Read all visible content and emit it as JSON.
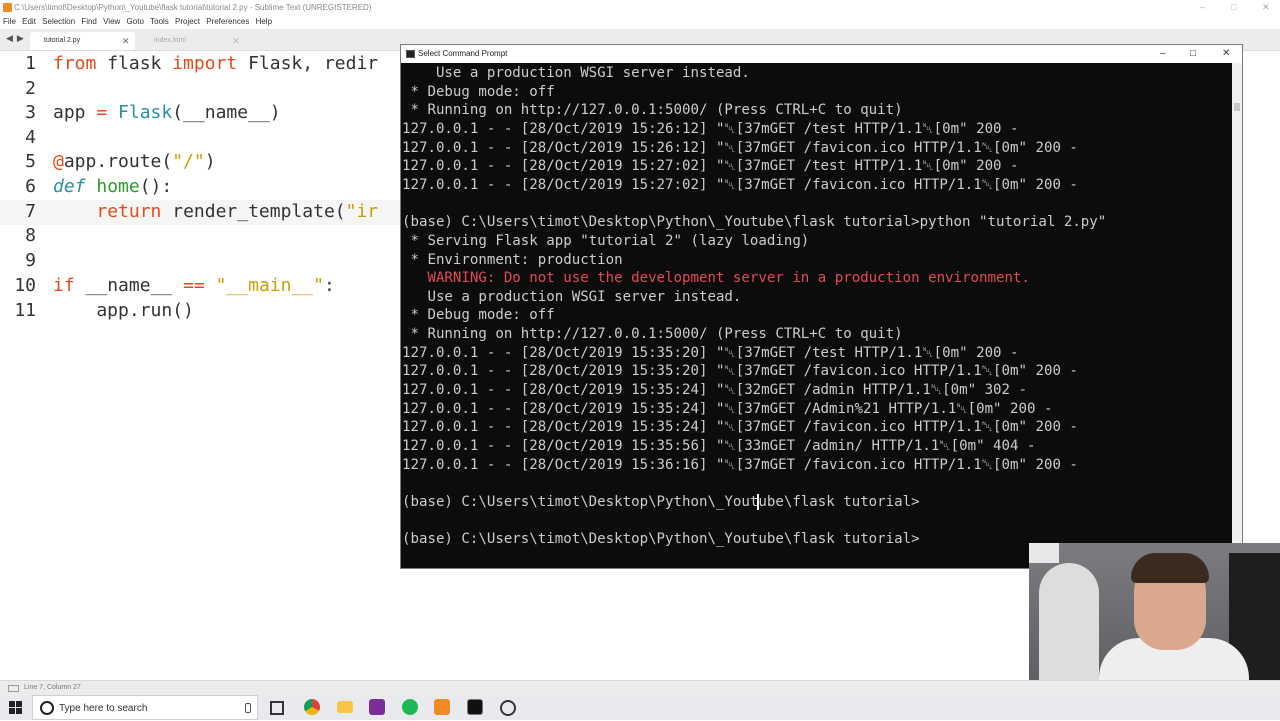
{
  "sublime": {
    "title": "C:\\Users\\timot\\Desktop\\Python\\_Youtube\\flask tutorial\\tutorial 2.py - Sublime Text (UNREGISTERED)",
    "menu": [
      "File",
      "Edit",
      "Selection",
      "Find",
      "View",
      "Goto",
      "Tools",
      "Project",
      "Preferences",
      "Help"
    ],
    "tabs": [
      {
        "label": "tutorial 2.py",
        "active": true
      },
      {
        "label": "index.html",
        "active": false
      }
    ],
    "line_numbers": [
      "1",
      "2",
      "3",
      "4",
      "5",
      "6",
      "7",
      "8",
      "9",
      "10",
      "11"
    ],
    "code": {
      "l1": {
        "kw1": "from",
        "t1": " flask ",
        "kw2": "import",
        "t2": " Flask, redir"
      },
      "l3": {
        "t1": "app ",
        "op": "=",
        "t2": " ",
        "cls": "Flask",
        "t3": "(__name__)"
      },
      "l5": {
        "at": "@",
        "t1": "app.route(",
        "str": "\"/\"",
        "t2": ")"
      },
      "l6": {
        "kw": "def",
        "t1": " ",
        "fn": "home",
        "t2": "():"
      },
      "l7": {
        "ind": "    ",
        "kw": "return",
        "t1": " render_template(",
        "str": "\"ir"
      },
      "l10": {
        "kw": "if",
        "t1": " __name__ ",
        "op": "==",
        "t2": " ",
        "str": "\"__main__\"",
        "t3": ":"
      },
      "l11": {
        "t1": "    app.run()"
      }
    },
    "status": "Line 7, Column 27"
  },
  "cmd": {
    "title": "Select Command Prompt",
    "lines": [
      {
        "text": "    Use a production WSGI server instead.",
        "type": "normal"
      },
      {
        "text": " * Debug mode: off",
        "type": "normal"
      },
      {
        "text": " * Running on http://127.0.0.1:5000/ (Press CTRL+C to quit)",
        "type": "normal"
      },
      {
        "text": "127.0.0.1 - - [28/Oct/2019 15:26:12] \"␀[37mGET /test HTTP/1.1␀[0m\" 200 -",
        "type": "normal"
      },
      {
        "text": "127.0.0.1 - - [28/Oct/2019 15:26:12] \"␀[37mGET /favicon.ico HTTP/1.1␀[0m\" 200 -",
        "type": "normal"
      },
      {
        "text": "127.0.0.1 - - [28/Oct/2019 15:27:02] \"␀[37mGET /test HTTP/1.1␀[0m\" 200 -",
        "type": "normal"
      },
      {
        "text": "127.0.0.1 - - [28/Oct/2019 15:27:02] \"␀[37mGET /favicon.ico HTTP/1.1␀[0m\" 200 -",
        "type": "normal"
      },
      {
        "text": "",
        "type": "normal"
      },
      {
        "text": "(base) C:\\Users\\timot\\Desktop\\Python\\_Youtube\\flask tutorial>python \"tutorial 2.py\"",
        "type": "normal"
      },
      {
        "text": " * Serving Flask app \"tutorial 2\" (lazy loading)",
        "type": "normal"
      },
      {
        "text": " * Environment: production",
        "type": "normal"
      },
      {
        "text": "   WARNING: Do not use the development server in a production environment.",
        "type": "warn"
      },
      {
        "text": "   Use a production WSGI server instead.",
        "type": "normal"
      },
      {
        "text": " * Debug mode: off",
        "type": "normal"
      },
      {
        "text": " * Running on http://127.0.0.1:5000/ (Press CTRL+C to quit)",
        "type": "normal"
      },
      {
        "text": "127.0.0.1 - - [28/Oct/2019 15:35:20] \"␀[37mGET /test HTTP/1.1␀[0m\" 200 -",
        "type": "normal"
      },
      {
        "text": "127.0.0.1 - - [28/Oct/2019 15:35:20] \"␀[37mGET /favicon.ico HTTP/1.1␀[0m\" 200 -",
        "type": "normal"
      },
      {
        "text": "127.0.0.1 - - [28/Oct/2019 15:35:24] \"␀[32mGET /admin HTTP/1.1␀[0m\" 302 -",
        "type": "normal"
      },
      {
        "text": "127.0.0.1 - - [28/Oct/2019 15:35:24] \"␀[37mGET /Admin%21 HTTP/1.1␀[0m\" 200 -",
        "type": "normal"
      },
      {
        "text": "127.0.0.1 - - [28/Oct/2019 15:35:24] \"␀[37mGET /favicon.ico HTTP/1.1␀[0m\" 200 -",
        "type": "normal"
      },
      {
        "text": "127.0.0.1 - - [28/Oct/2019 15:35:56] \"␀[33mGET /admin/ HTTP/1.1␀[0m\" 404 -",
        "type": "normal"
      },
      {
        "text": "127.0.0.1 - - [28/Oct/2019 15:36:16] \"␀[37mGET /favicon.ico HTTP/1.1␀[0m\" 200 -",
        "type": "normal"
      },
      {
        "text": "",
        "type": "normal"
      },
      {
        "text": "(base) C:\\Users\\timot\\Desktop\\Python\\_Youtube\\flask tutorial>",
        "type": "normal"
      },
      {
        "text": "",
        "type": "normal"
      },
      {
        "text": "(base) C:\\Users\\timot\\Desktop\\Python\\_Youtube\\flask tutorial>",
        "type": "normal"
      }
    ]
  },
  "taskbar": {
    "search_placeholder": "Type here to search",
    "apps": [
      "task-view-icon",
      "chrome-icon",
      "file-explorer-icon",
      "onenote-icon",
      "spotify-icon",
      "sublime-icon",
      "cmd-icon",
      "obs-icon"
    ]
  },
  "colors": {
    "keyword": "#e64a19",
    "function": "#2a9d2a",
    "class": "#2a8f9f",
    "string": "#c8a100",
    "terminal_bg": "#0c0c0c",
    "terminal_fg": "#cccccc",
    "warning": "#e74856"
  }
}
